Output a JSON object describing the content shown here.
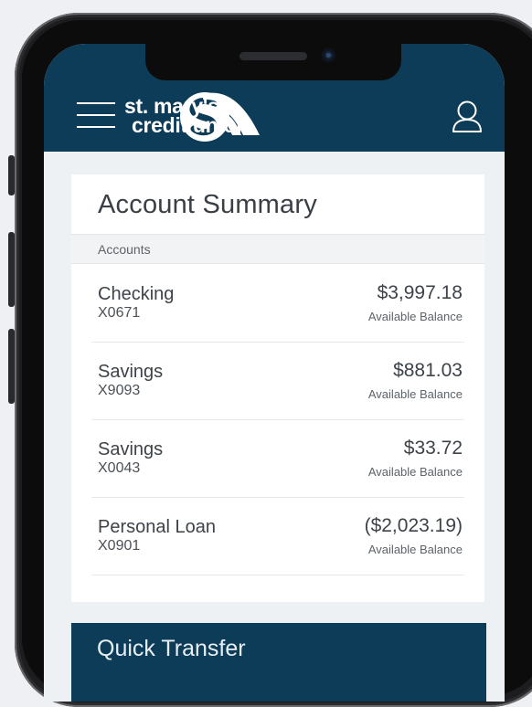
{
  "brand": {
    "line1": "st. mary's",
    "line2": "credit union",
    "header_color": "#0c3c58"
  },
  "header": {
    "menu_icon": "hamburger-menu-icon",
    "user_icon": "user-profile-icon"
  },
  "summary": {
    "title": "Account Summary",
    "section_label": "Accounts",
    "accounts": [
      {
        "name": "Checking",
        "number": "X0671",
        "balance": "$3,997.18",
        "caption": "Available Balance"
      },
      {
        "name": "Savings",
        "number": "X9093",
        "balance": "$881.03",
        "caption": "Available Balance"
      },
      {
        "name": "Savings",
        "number": "X0043",
        "balance": "$33.72",
        "caption": "Available Balance"
      },
      {
        "name": "Personal Loan",
        "number": "X0901",
        "balance": "($2,023.19)",
        "caption": "Available Balance"
      }
    ]
  },
  "quick_transfer": {
    "title": "Quick Transfer"
  }
}
